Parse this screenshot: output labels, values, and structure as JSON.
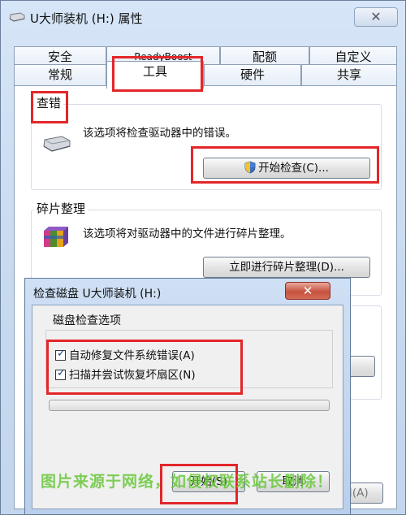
{
  "window": {
    "title": "U大师装机 (H:) 属性",
    "close_glyph": "✕"
  },
  "tabs_row1": [
    "安全",
    "ReadyBoost",
    "配额",
    "自定义"
  ],
  "tabs_row2": [
    "常规",
    "工具",
    "硬件",
    "共享"
  ],
  "error_check": {
    "title": "查错",
    "description": "该选项将检查驱动器中的错误。",
    "button": "开始检查(C)..."
  },
  "defrag": {
    "title": "碎片整理",
    "description": "该选项将对驱动器中的文件进行碎片整理。",
    "button": "立即进行碎片整理(D)..."
  },
  "bottom_apply": "用(A)",
  "dialog": {
    "title": "检查磁盘 U大师装机 (H:)",
    "close_glyph": "✕",
    "group_title": "磁盘检查选项",
    "options": [
      {
        "label": "自动修复文件系统错误(A)",
        "checked": true
      },
      {
        "label": "扫描并尝试恢复坏扇区(N)",
        "checked": true
      }
    ],
    "progress": 0,
    "start": "开始(S)",
    "cancel": "取消"
  },
  "watermark": "图片来源于网络，如侵权联系站长删除！",
  "colors": {
    "highlight_box": "#e3262a",
    "watermark": "#69c83b"
  }
}
